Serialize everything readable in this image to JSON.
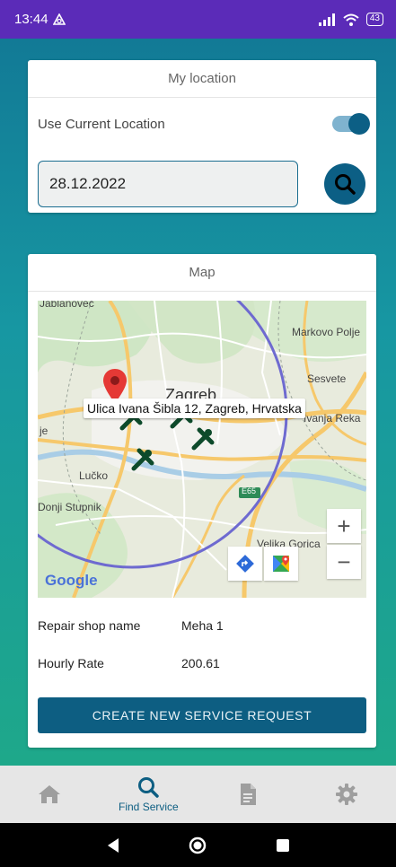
{
  "status_bar": {
    "time": "13:44",
    "battery": "43"
  },
  "location_card": {
    "title": "My location",
    "use_current_label": "Use Current Location",
    "use_current_enabled": true,
    "date_value": "28.12.2022"
  },
  "map_card": {
    "title": "Map",
    "map": {
      "tooltip": "Ulica Ivana Šibla 12, Zagreb, Hrvatska",
      "labels": {
        "jablanovec": "Jablanovec",
        "markovo_polje": "Markovo Polje",
        "sesvete": "Sesvete",
        "zagreb": "Zagreb",
        "ivanja_reka": "Ivanja Reka",
        "lucko": "Lučko",
        "donji_stupnik": "Donji Stupnik",
        "velika_gorica": "Velika Gorica",
        "road": "E65",
        "je": "je",
        "google": "Google"
      },
      "zoom_in": "+",
      "zoom_out": "−"
    },
    "repair_shop_label": "Repair shop name",
    "repair_shop_value": "Meha 1",
    "hourly_rate_label": "Hourly Rate",
    "hourly_rate_value": "200.61",
    "create_button": "CREATE NEW SERVICE REQUEST"
  },
  "bottom_nav": {
    "find_service": "Find Service",
    "active": "find_service"
  },
  "colors": {
    "status_bar": "#5b2bb8",
    "primary": "#0c5f85",
    "background_top": "#127a96",
    "background_bottom": "#1ea88a"
  }
}
